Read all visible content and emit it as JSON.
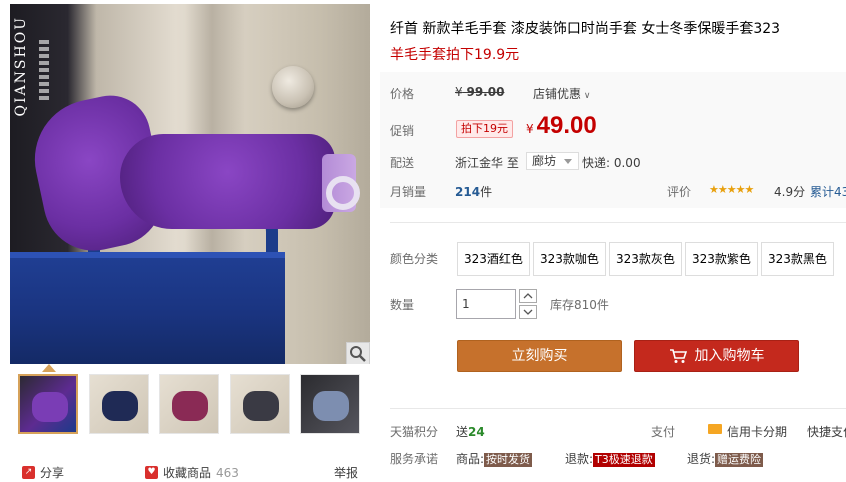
{
  "gallery": {
    "brand_text": "QIANSHOU",
    "thumbnails": [
      {
        "name": "thumb-purple",
        "color": "#5d2b91"
      },
      {
        "name": "thumb-coffee",
        "color": "#4a3a2e"
      },
      {
        "name": "thumb-wine",
        "color": "#7a1f44"
      },
      {
        "name": "thumb-gray",
        "color": "#5a5a62"
      },
      {
        "name": "thumb-black",
        "color": "#2b2b2f"
      }
    ],
    "share_label": "分享",
    "favorite_label": "收藏商品",
    "favorite_count": "463",
    "report_label": "举报"
  },
  "product": {
    "title": "纤首 新款羊毛手套 漆皮装饰口时尚手套 女士冬季保暖手套323",
    "subtitle": "羊毛手套拍下19.9元"
  },
  "price": {
    "label": "价格",
    "currency": "¥",
    "original": "99.00",
    "shop_promo": "店铺优惠"
  },
  "promo": {
    "label": "促销",
    "tag": "拍下19元",
    "currency": "¥",
    "price": "49.00"
  },
  "shipping": {
    "label": "配送",
    "from": "浙江金华",
    "to_prefix": "至",
    "to": "廊坊",
    "fee": "快递: 0.00"
  },
  "sales": {
    "label": "月销量",
    "count": "214",
    "unit": "件",
    "review_label": "评价",
    "stars": "★★★★★",
    "score": "4.9分",
    "review_count": "累计43"
  },
  "sku": {
    "label": "颜色分类",
    "options": [
      "323酒红色",
      "323款咖色",
      "323款灰色",
      "323款紫色",
      "323款黑色"
    ]
  },
  "quantity": {
    "label": "数量",
    "value": "1",
    "stock": "库存810件"
  },
  "buttons": {
    "buy_now": "立刻购买",
    "add_cart": "加入购物车"
  },
  "extras": {
    "points_label": "天猫积分",
    "points_prefix": "送",
    "points_value": "24",
    "pay_label": "支付",
    "credit": "信用卡分期",
    "quickpay": "快捷支付",
    "service_label": "服务承诺",
    "svc1_prefix": "商品:",
    "svc1_badge": "按时发货",
    "svc2_prefix": "退款:",
    "svc2_badge": "T3极速退款",
    "svc3_prefix": "退货:",
    "svc3_badge": "赠运费险"
  },
  "colors": {
    "price_red": "#c40000",
    "buy_now_orange": "#c6712c",
    "add_cart_red": "#c4291d",
    "link_blue": "#265b94",
    "star_gold": "#e8a00d"
  }
}
